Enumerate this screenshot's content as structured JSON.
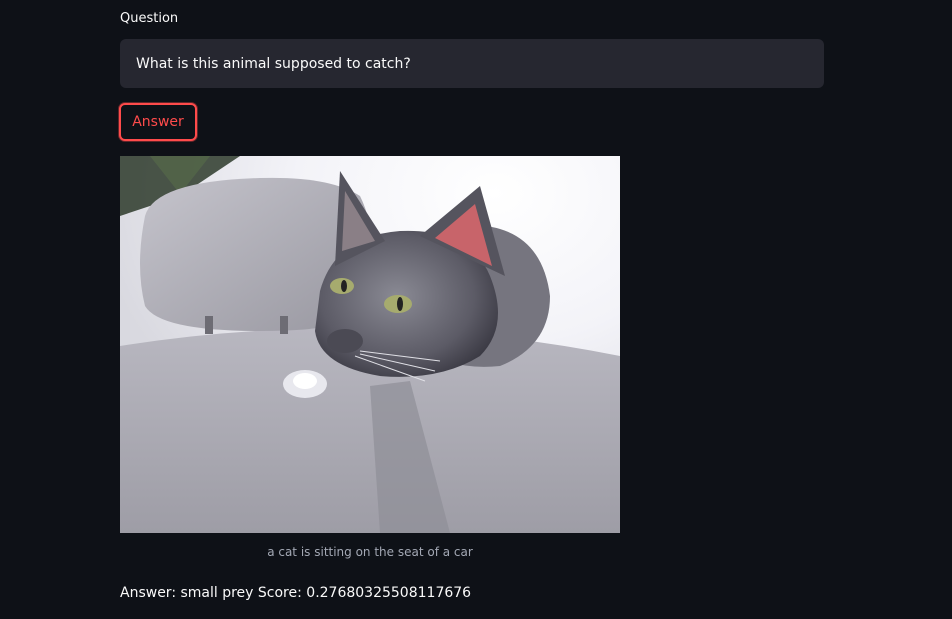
{
  "question": {
    "label": "Question",
    "value": "What is this animal supposed to catch?"
  },
  "answer_button": {
    "label": "Answer"
  },
  "image": {
    "caption": "a cat is sitting on the seat of a car"
  },
  "result": {
    "text": "Answer: small prey Score: 0.27680325508117676"
  },
  "colors": {
    "background": "#0e1117",
    "input_background": "#262730",
    "accent": "#ff4b4b"
  }
}
